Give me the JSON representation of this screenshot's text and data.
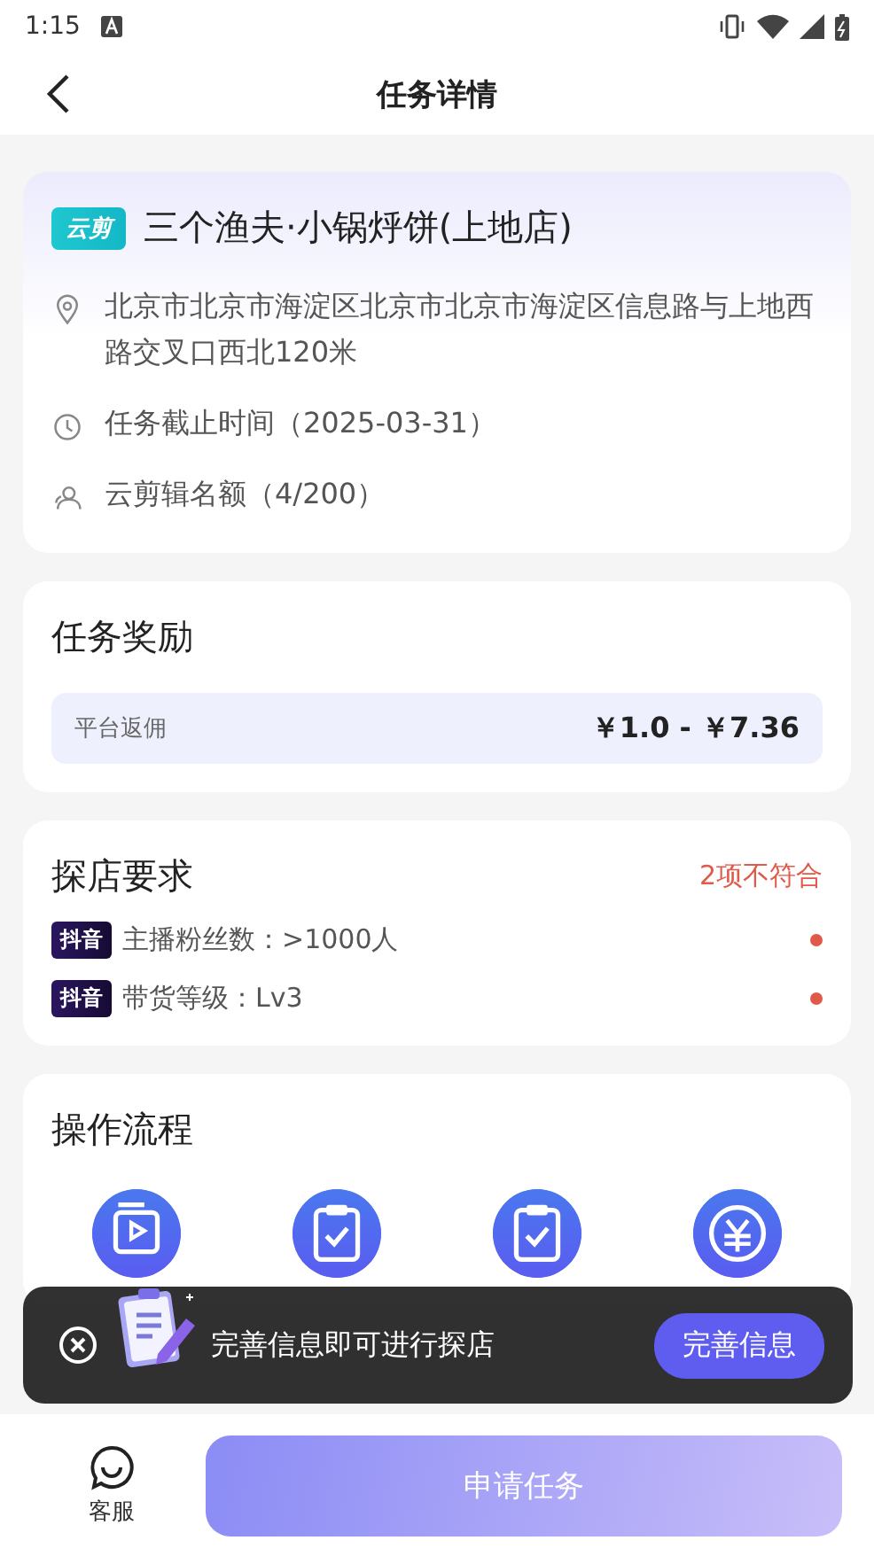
{
  "status_bar": {
    "time": "1:15"
  },
  "nav": {
    "title": "任务详情"
  },
  "store": {
    "tag": "云剪",
    "name": "三个渔夫·小锅烀饼(上地店)",
    "info": [
      {
        "kind": "location",
        "text": "北京市北京市海淀区北京市北京市海淀区信息路与上地西路交叉口西北120米"
      },
      {
        "kind": "clock",
        "text": "任务截止时间（2025-03-31）"
      },
      {
        "kind": "people",
        "text": "云剪辑名额（4/200）"
      }
    ]
  },
  "reward": {
    "title": "任务奖励",
    "label": "平台返佣",
    "amount": "￥1.0 - ￥7.36"
  },
  "requirements": {
    "title": "探店要求",
    "summary": "2项不符合",
    "items": [
      {
        "platform": "抖音",
        "text": "主播粉丝数：>1000人",
        "met": false
      },
      {
        "platform": "抖音",
        "text": "带货等级：Lv3",
        "met": false
      }
    ]
  },
  "process": {
    "title": "操作流程",
    "steps": [
      {
        "kind": "video"
      },
      {
        "kind": "clipboard"
      },
      {
        "kind": "clipboard"
      },
      {
        "kind": "coin"
      }
    ]
  },
  "toast": {
    "message": "完善信息即可进行探店",
    "button": "完善信息"
  },
  "bottom_bar": {
    "service": "客服",
    "apply": "申请任务"
  }
}
